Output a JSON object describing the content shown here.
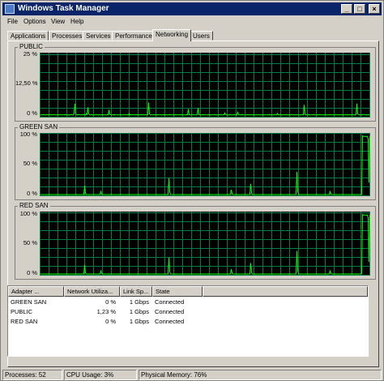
{
  "window": {
    "title": "Windows Task Manager"
  },
  "menu": [
    "File",
    "Options",
    "View",
    "Help"
  ],
  "tabs": [
    "Applications",
    "Processes",
    "Services",
    "Performance",
    "Networking",
    "Users"
  ],
  "active_tab": "Networking",
  "graphs": [
    {
      "name": "PUBLIC",
      "ticks": [
        "25 %",
        "12,50 %",
        "0 %"
      ],
      "max_percent": 25,
      "series": [
        0.4,
        0.5,
        0.4,
        0.6,
        0.4,
        0.5,
        0.4,
        0.5,
        0.4,
        0.6,
        0.5,
        0.4,
        0.5,
        0.4,
        0.6,
        0.4,
        0.5,
        0.4,
        0.5,
        0.4,
        0.5,
        0.6,
        0.4,
        0.5,
        0.4,
        0.5,
        0.4,
        0.6,
        0.4,
        0.5,
        0.4,
        0.5,
        0.4,
        0.5,
        0.6,
        0.4,
        1.0,
        5.0,
        1.0,
        0.5,
        0.4,
        0.6,
        0.5,
        0.4,
        0.5,
        0.4,
        0.6,
        0.4,
        0.5,
        0.4,
        0.5,
        3.5,
        0.8,
        0.5,
        0.4,
        0.6,
        0.5,
        0.4,
        0.5,
        0.4,
        0.6,
        0.4,
        0.5,
        0.4,
        0.5,
        0.4,
        0.6,
        0.4,
        0.5,
        0.4,
        0.5,
        0.4,
        0.6,
        0.4,
        2.5,
        0.6,
        0.5,
        0.4,
        0.5,
        0.4,
        0.6,
        0.4,
        0.5,
        0.4,
        0.5,
        0.4,
        0.6,
        0.4,
        0.5,
        0.4,
        0.5,
        0.4,
        0.6,
        0.4,
        0.5,
        0.4,
        0.5,
        0.4,
        0.6,
        0.4,
        0.5,
        0.4,
        0.5,
        0.4,
        0.6,
        0.4,
        0.5,
        0.4,
        0.5,
        0.4,
        0.6,
        0.4,
        0.5,
        0.4,
        0.5,
        0.4,
        0.6,
        0.4,
        0.5,
        0.4,
        0.5,
        0.4,
        0.6,
        0.4,
        0.5,
        0.4,
        0.5,
        0.4,
        0.6,
        0.4,
        0.5,
        0.4,
        0.5,
        0.4,
        0.6,
        0.4,
        0.5,
        0.4,
        0.5,
        0.4,
        0.6,
        0.4,
        0.5,
        0.4,
        0.5,
        0.4,
        0.6,
        0.4,
        0.5,
        0.4,
        0.5,
        0.4,
        0.6,
        0.4,
        0.5,
        0.4,
        0.5,
        0.4,
        0.6,
        0.4,
        0.5,
        0.4,
        0.5,
        0.4,
        0.6,
        0.4,
        0.5,
        0.4,
        0.5,
        0.4,
        0.6,
        0.4,
        0.5,
        0.4,
        0.5,
        0.4,
        0.6,
        0.4,
        0.5,
        0.4,
        0.5,
        0.4,
        0.6,
        0.4,
        0.5,
        0.4,
        0.5,
        0.4,
        0.6,
        0.4,
        0.5,
        0.4,
        0.5,
        0.4,
        0.6,
        0.4,
        0.5,
        0.4,
        0.5,
        0.4,
        0.6,
        0.4,
        0.5,
        0.4,
        0.5,
        0.4,
        0.6,
        0.4,
        0.5,
        0.4,
        0.5,
        0.4,
        0.6,
        0.4,
        0.5,
        0.4,
        0.5,
        0.4,
        0.6,
        0.4,
        0.5,
        0.4,
        0.5,
        0.4,
        0.6,
        0.4,
        0.5,
        0.4,
        0.5,
        0.4,
        0.6,
        0.4,
        0.5,
        0.4,
        0.5,
        0.4,
        0.6,
        0.4,
        0.5,
        0.4,
        0.5,
        0.4,
        0.6,
        0.4,
        0.5,
        0.4,
        0.5,
        0.4,
        0.6,
        0.4,
        0.5,
        0.4,
        0.5,
        0.4,
        0.6,
        0.4,
        0.5,
        0.4,
        0.5,
        0.4,
        0.6,
        0.4,
        0.5,
        0.4,
        0.5,
        0.4,
        0.6,
        0.4,
        0.5,
        0.4,
        0.5,
        0.4,
        0.6,
        0.4,
        0.5,
        0.4,
        0.5,
        0.4,
        0.6,
        0.4,
        0.5,
        0.4,
        0.5,
        0.4,
        0.6,
        0.4,
        0.5,
        0.4,
        0.5,
        0.4,
        0.6,
        0.4,
        0.5,
        0.4,
        0.5,
        0.4,
        0.6,
        0.4,
        0.5,
        0.4,
        0.5,
        0.4,
        0.6,
        0.4,
        0.5,
        0.4,
        0.5,
        0.4,
        0.6,
        0.4,
        0.5,
        0.4,
        0.5,
        0.4,
        0.6,
        0.4,
        0.5,
        0.4,
        0.5,
        0.4,
        0.6,
        0.4,
        0.5,
        0.4,
        0.5,
        0.4,
        0.6,
        0.4,
        0.5,
        0.4,
        0.5,
        0.4,
        0.6,
        0.4,
        0.5,
        0.4,
        0.5,
        0.4,
        0.6,
        0.4,
        0.5,
        0.4,
        0.5,
        0.4,
        0.6,
        0.4,
        0.5,
        0.4,
        0.5,
        0.4,
        0.6,
        0.4,
        0.5,
        0.4,
        0.5,
        0.4,
        0.6,
        0.4
      ],
      "spikes": [
        [
          0.33,
          5.5
        ],
        [
          0.45,
          2.8
        ],
        [
          0.48,
          3.2
        ],
        [
          0.6,
          1.5
        ],
        [
          0.8,
          4.5
        ],
        [
          0.96,
          5.0
        ],
        [
          0.56,
          1.2
        ],
        [
          0.72,
          1.0
        ],
        [
          0.14,
          0.9
        ],
        [
          0.27,
          1.0
        ]
      ]
    },
    {
      "name": "GREEN SAN",
      "ticks": [
        "100 %",
        "50 %",
        "0 %"
      ],
      "max_percent": 100,
      "spikes": [
        [
          0.135,
          15
        ],
        [
          0.185,
          5
        ],
        [
          0.39,
          27
        ],
        [
          0.58,
          8
        ],
        [
          0.64,
          18
        ],
        [
          0.78,
          38
        ],
        [
          0.88,
          5
        ]
      ],
      "high_start": 0.975,
      "high_value": 100
    },
    {
      "name": "RED SAN",
      "ticks": [
        "100 %",
        "50 %",
        "0 %"
      ],
      "max_percent": 100,
      "spikes": [
        [
          0.135,
          15
        ],
        [
          0.185,
          5
        ],
        [
          0.39,
          27
        ],
        [
          0.58,
          8
        ],
        [
          0.64,
          18
        ],
        [
          0.78,
          38
        ],
        [
          0.88,
          5
        ]
      ],
      "high_start": 0.975,
      "high_value": 100
    }
  ],
  "adapters": {
    "columns": [
      "Adapter ...",
      "Network Utiliza...",
      "Link Sp...",
      "State"
    ],
    "rows": [
      {
        "name": "GREEN SAN",
        "utilization": "0 %",
        "speed": "1 Gbps",
        "state": "Connected"
      },
      {
        "name": "PUBLIC",
        "utilization": "1,23 %",
        "speed": "1 Gbps",
        "state": "Connected"
      },
      {
        "name": "RED SAN",
        "utilization": "0 %",
        "speed": "1 Gbps",
        "state": "Connected"
      }
    ]
  },
  "status": {
    "processes": "Processes: 52",
    "cpu": "CPU Usage: 3%",
    "memory": "Physical Memory: 76%"
  },
  "colors": {
    "graph_bg": "#000000",
    "grid": "#008040",
    "line": "#00ff00",
    "title_bar": "#0a246a"
  },
  "icons": [
    "task-manager-icon",
    "minimize-icon",
    "maximize-icon",
    "close-icon"
  ]
}
